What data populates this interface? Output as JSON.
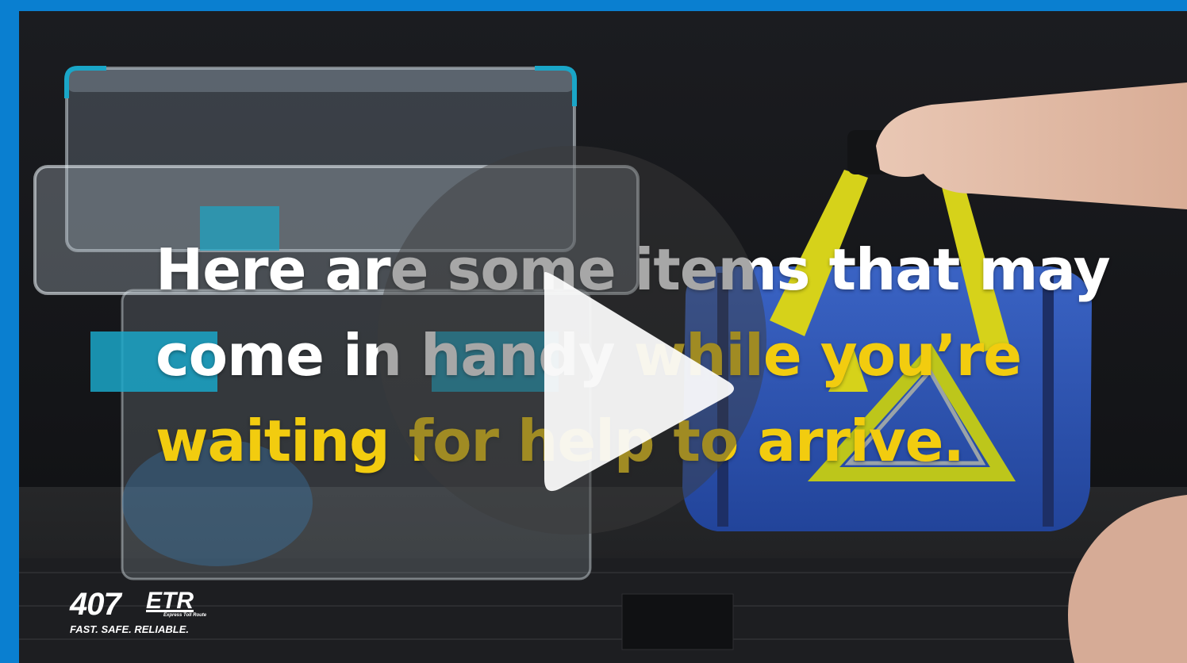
{
  "video": {
    "caption": {
      "line1": "Here are some items that may",
      "line2_white": "come in handy ",
      "line2_yellow": "while you’re",
      "line3": "waiting for help to arrive."
    },
    "play_button": {
      "icon": "play-icon"
    }
  },
  "logo": {
    "number": "407",
    "brand": "ETR",
    "subtitle": "Express Toll Route",
    "tagline": "FAST. SAFE. RELIABLE."
  },
  "colors": {
    "frame_border": "#0a7fd0",
    "caption_white": "#ffffff",
    "caption_yellow": "#f2cc0f",
    "bag_blue": "#2f58b6",
    "strap_yellow": "#d6d21a",
    "box_accent": "#1aa6c8"
  }
}
